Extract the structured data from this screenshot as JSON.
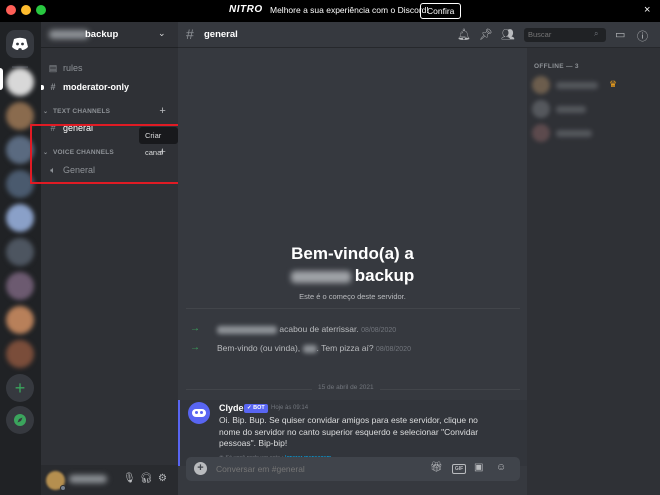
{
  "titlebar": {
    "nitro_label": "NITRO",
    "promo_text": "Melhore a sua experiência com o Discord!",
    "cta_label": "Confira",
    "close_glyph": "×"
  },
  "server": {
    "name_visible": "backup",
    "chevron": "⌄"
  },
  "channels": {
    "rules": "rules",
    "moderator": "moderator-only",
    "text_category": "TEXT CHANNELS",
    "text_general": "general",
    "voice_category": "VOICE CHANNELS",
    "voice_general": "General",
    "tooltip": "Criar canal"
  },
  "header": {
    "channel_name": "general",
    "search_placeholder": "Buscar"
  },
  "welcome": {
    "title_line1": "Bem-vindo(a) a",
    "title_line2": "backup",
    "subtitle": "Este é o começo deste servidor."
  },
  "system_messages": [
    {
      "text": "acabou de aterrissar.",
      "timestamp": "08/08/2020"
    },
    {
      "prefix": "Bem-vindo (ou vinda),",
      "suffix": ". Tem pizza aí?",
      "timestamp": "08/08/2020"
    }
  ],
  "date_divider": "15 de abril de 2021",
  "bot_message": {
    "author": "Clyde",
    "tag": "✓ BOT",
    "time": "Hoje às 09:14",
    "body": "Oi. Bip. Bup. Se quiser convidar amigos para este servidor, clique no nome do servidor no canto superior esquerdo e selecionar \"Convidar pessoas\". Bip-bip!",
    "footer_note": "Só você pode ver esta",
    "footer_sep": " • ",
    "footer_link": "Ignorar mensagem"
  },
  "composer": {
    "placeholder": "Conversar em #general"
  },
  "members": {
    "header": "OFFLINE — 3"
  },
  "colors": {
    "accent": "#5865f2",
    "green": "#3ba55d",
    "highlight_box": "#e01b24"
  },
  "icons": [
    "discord-logo-icon",
    "rules-icon",
    "hash-icon",
    "speaker-icon",
    "plus-icon",
    "bell-icon",
    "pin-icon",
    "members-icon",
    "search-icon",
    "inbox-icon",
    "help-icon",
    "mic-icon",
    "headphones-icon",
    "settings-icon",
    "gift-icon",
    "gif-icon",
    "sticker-icon",
    "emoji-icon",
    "compass-icon",
    "crown-icon"
  ]
}
